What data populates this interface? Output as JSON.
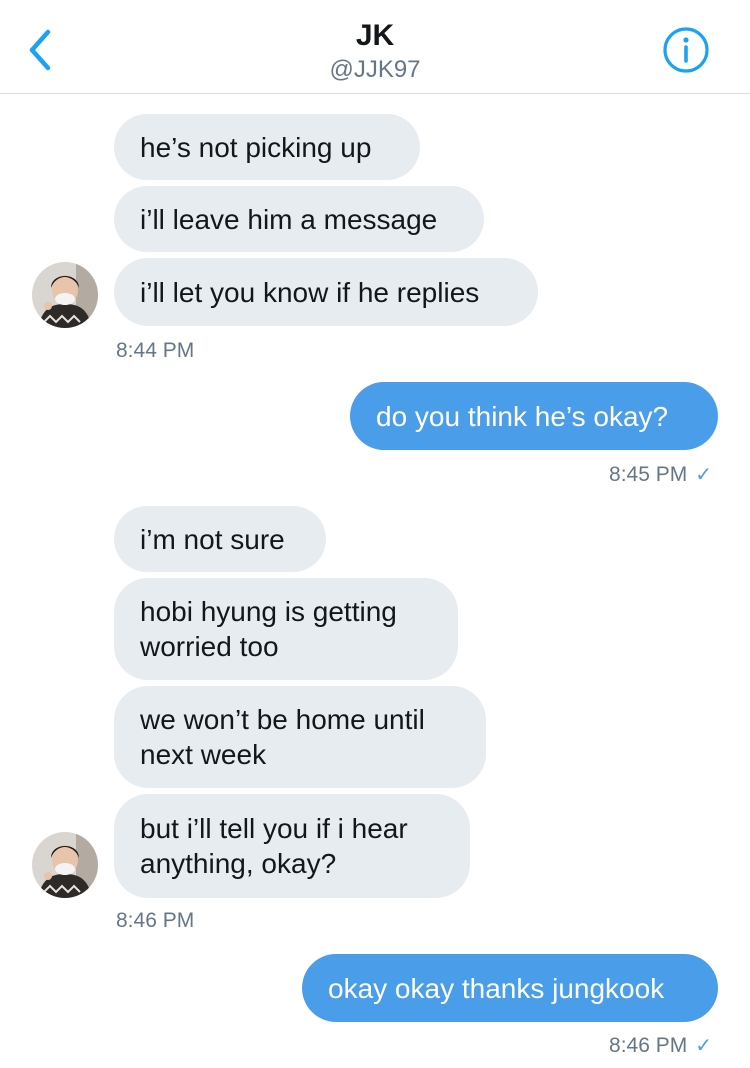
{
  "header": {
    "title": "JK",
    "handle": "@JJK97",
    "back_icon": "chevron-left-icon",
    "info_icon": "info-circle-icon",
    "accent_color": "#1da1f2"
  },
  "colors": {
    "incoming_bubble": "#e6ecf0",
    "outgoing_bubble": "#4a9de9",
    "timestamp": "#657786"
  },
  "messages": {
    "g1": {
      "m1": "he’s not picking up",
      "m2": "i’ll leave him a message",
      "m3": "i’ll let you know if he replies",
      "time": "8:44 PM"
    },
    "o1": {
      "text": "do you think he’s okay?",
      "time": "8:45 PM",
      "read_icon": "checkmark-icon"
    },
    "g2": {
      "m1": "i’m not sure",
      "m2_l1": "hobi hyung is getting",
      "m2_l2": "worried too",
      "m3_l1": "we won’t be home until",
      "m3_l2": "next week",
      "m4_l1": "but i’ll tell you if i hear",
      "m4_l2": "anything, okay?",
      "time": "8:46 PM"
    },
    "o2": {
      "text": "okay okay thanks jungkook",
      "time": "8:46 PM",
      "read_icon": "checkmark-icon"
    }
  },
  "check_glyph": "✓"
}
